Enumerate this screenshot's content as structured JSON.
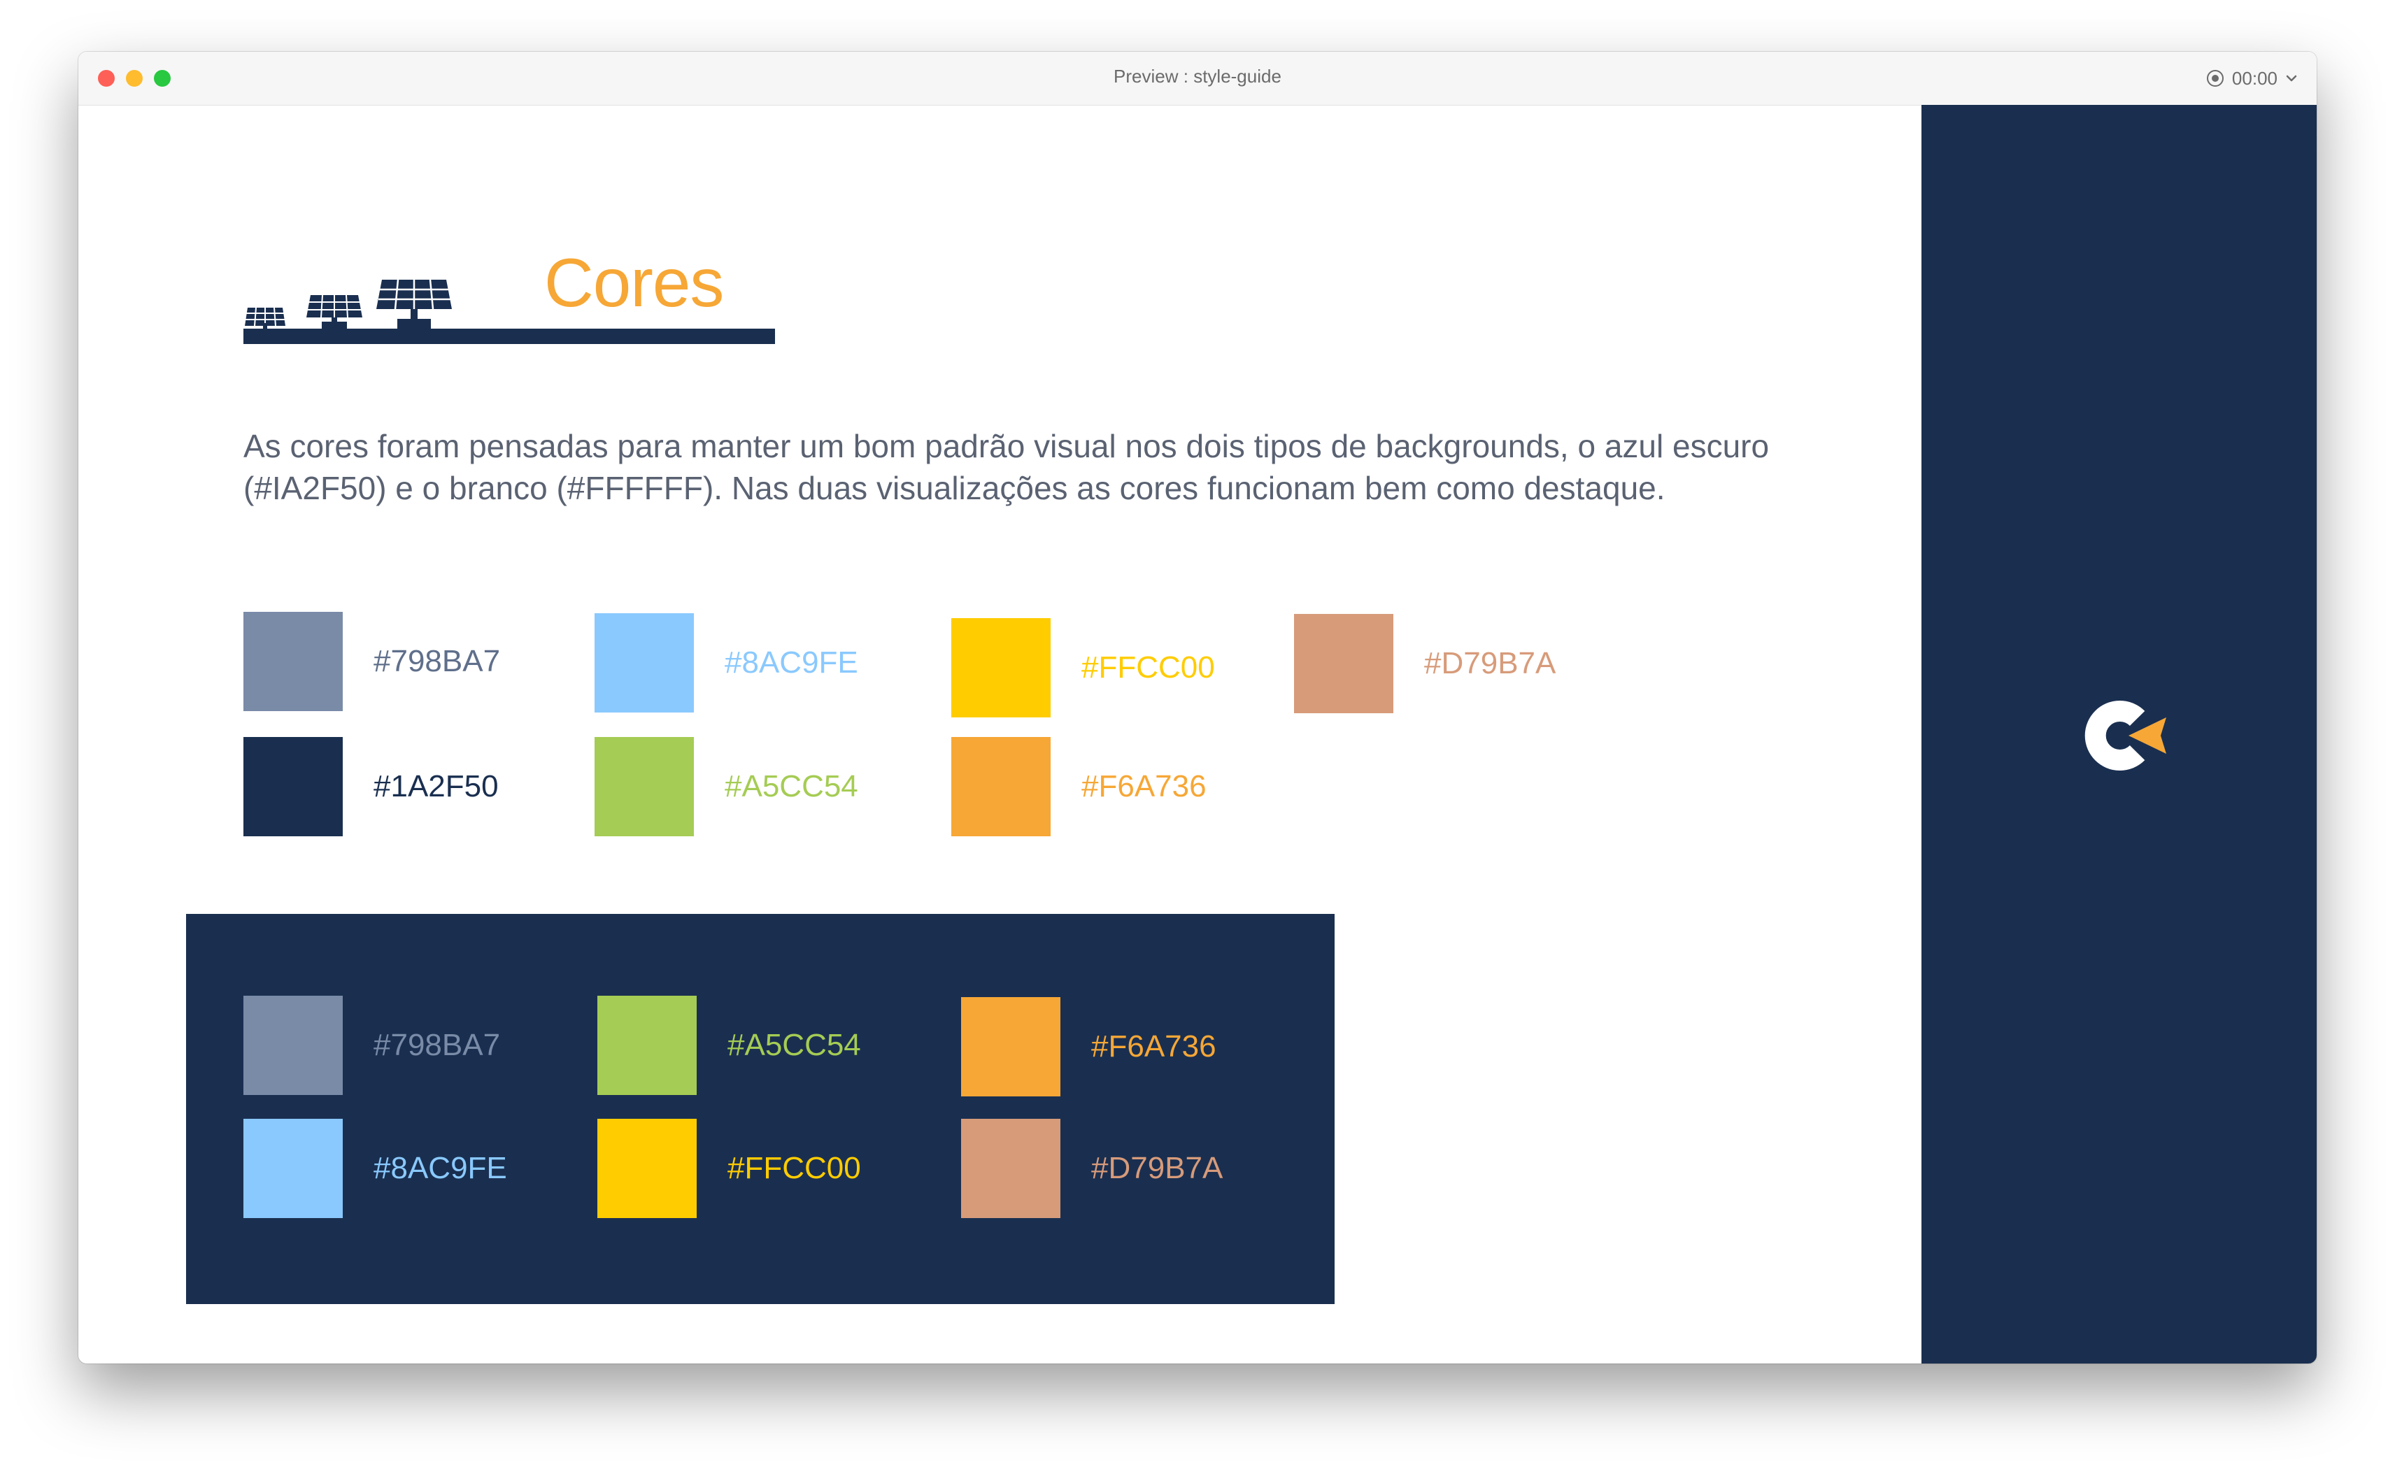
{
  "window": {
    "title": "Preview : style-guide",
    "timer": "00:00"
  },
  "slide": {
    "title": "Cores",
    "description_line1": "As cores foram pensadas para manter um bom padrão visual nos dois tipos de backgrounds, o azul escuro",
    "description_line2": "(#IA2F50) e o branco (#FFFFFF). Nas duas visualizações as cores funcionam bem como destaque."
  },
  "light_palette": [
    {
      "label": "#798BA7",
      "color": "#798ba7",
      "text_color": "#5f6f8b"
    },
    {
      "label": "#8AC9FE",
      "color": "#8ac9fe",
      "text_color": "#8ac9fe"
    },
    {
      "label": "#FFCC00",
      "color": "#ffcc00",
      "text_color": "#ffcc00"
    },
    {
      "label": "#D79B7A",
      "color": "#d79b7a",
      "text_color": "#d79b7a"
    },
    {
      "label": "#1A2F50",
      "color": "#1a2f50",
      "text_color": "#1a2f50"
    },
    {
      "label": "#A5CC54",
      "color": "#a5cc54",
      "text_color": "#a5cc54"
    },
    {
      "label": "#F6A736",
      "color": "#f6a736",
      "text_color": "#f6a736"
    }
  ],
  "dark_palette": [
    {
      "label": "#798BA7",
      "color": "#798ba7",
      "text_color": "#798ba7"
    },
    {
      "label": "#A5CC54",
      "color": "#a5cc54",
      "text_color": "#a5cc54"
    },
    {
      "label": "#F6A736",
      "color": "#f6a736",
      "text_color": "#f6a736"
    },
    {
      "label": "#8AC9FE",
      "color": "#8ac9fe",
      "text_color": "#8ac9fe"
    },
    {
      "label": "#FFCC00",
      "color": "#ffcc00",
      "text_color": "#ffcc00"
    },
    {
      "label": "#D79B7A",
      "color": "#d79b7a",
      "text_color": "#d79b7a"
    }
  ],
  "colors": {
    "navy": "#1a2f50",
    "accent": "#f6a736"
  },
  "icons": {
    "record": "record-icon",
    "chevron": "chevron-down-icon",
    "solar": "solar-panels-icon",
    "logo": "logo-icon"
  }
}
